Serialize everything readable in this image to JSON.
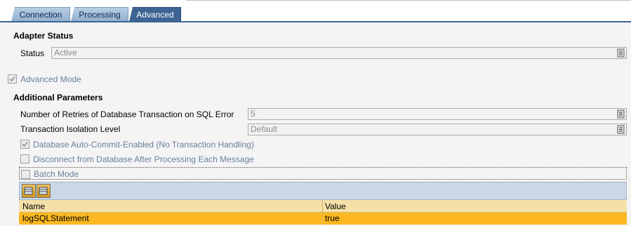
{
  "tabs": [
    {
      "label": "Connection",
      "active": false
    },
    {
      "label": "Processing",
      "active": false
    },
    {
      "label": "Advanced",
      "active": true
    }
  ],
  "adapter_status": {
    "heading": "Adapter Status",
    "status_label": "Status",
    "status_value": "Active"
  },
  "advanced_mode": {
    "label": "Advanced Mode",
    "checked": true
  },
  "additional": {
    "heading": "Additional Parameters",
    "retries_label": "Number of Retries of Database Transaction on SQL Error",
    "retries_value": "5",
    "isolation_label": "Transaction Isolation Level",
    "isolation_value": "Default",
    "auto_commit_label": "Database Auto-Commit-Enabled (No Transaction Handling)",
    "auto_commit_checked": true,
    "disconnect_label": "Disconnect from Database After Processing Each Message",
    "disconnect_checked": false,
    "batch_label": "Batch Mode",
    "batch_checked": false
  },
  "table": {
    "columns": [
      "Name",
      "Value"
    ],
    "rows": [
      {
        "name": "logSQLStatement",
        "value": "true"
      }
    ]
  },
  "colors": {
    "tab_active": "#3c6494",
    "row_selected": "#fbb820",
    "header": "#f5e1a8"
  }
}
